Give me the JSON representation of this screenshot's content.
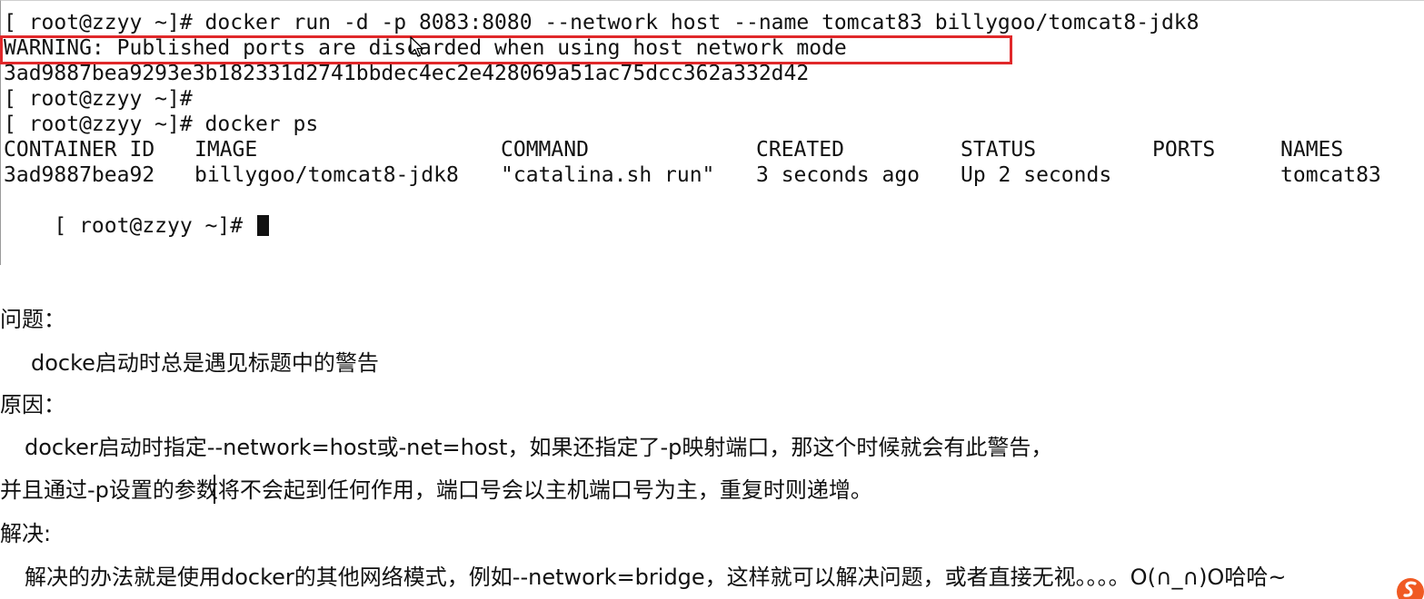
{
  "terminal": {
    "lines": [
      "[ root@zzyy ~]# docker run -d -p 8083:8080 --network host --name tomcat83 billygoo/tomcat8-jdk8",
      "WARNING: Published ports are discarded when using host network mode",
      "3ad9887bea9293e3b182331d2741bbdec4ec2e428069a51ac75dcc362a332d42",
      "[ root@zzyy ~]#",
      "[ root@zzyy ~]# docker ps"
    ],
    "table": {
      "headers": [
        "CONTAINER ID",
        "IMAGE",
        "COMMAND",
        "CREATED",
        "STATUS",
        "PORTS",
        "NAMES"
      ],
      "rows": [
        [
          "3ad9887bea92",
          "billygoo/tomcat8-jdk8",
          "\"catalina.sh run\"",
          "3 seconds ago",
          "Up 2 seconds",
          "",
          "tomcat83"
        ]
      ]
    },
    "prompt": "[ root@zzyy ~]#",
    "highlight_color": "#e0282a"
  },
  "notes": {
    "question_heading": "问题：",
    "question_text": "docke启动时总是遇见标题中的警告",
    "reason_heading": "原因：",
    "reason_line1": "docker启动时指定--network=host或-net=host，如果还指定了-p映射端口，那这个时候就会有此警告，",
    "reason_line2": "并且通过-p设置的参数将不会起到任何作用，端口号会以主机端口号为主，重复时则递增。",
    "solution_heading": "解决:",
    "solution_text": "解决的办法就是使用docker的其他网络模式，例如--network=bridge，这样就可以解决问题，或者直接无视。。。。O(∩_∩)O哈哈~"
  },
  "icons": {
    "pointer": "mouse-pointer-icon",
    "ime": "sogou-ime-icon"
  }
}
